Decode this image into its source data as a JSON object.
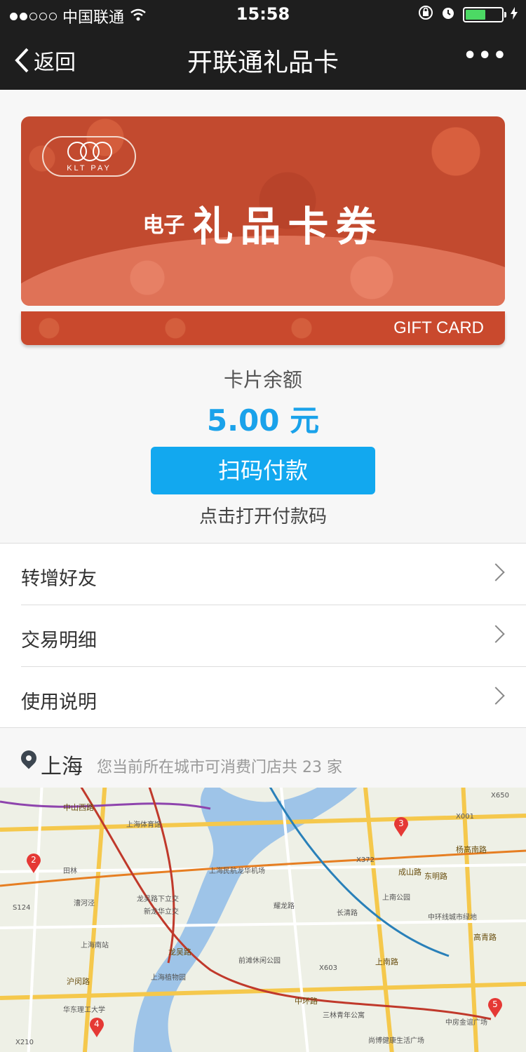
{
  "status_bar": {
    "carrier": "中国联通",
    "time": "15:58"
  },
  "nav": {
    "back_label": "返回",
    "title": "开联通礼品卡",
    "more_label": "•••"
  },
  "card": {
    "logo_text": "KLT PAY",
    "title_small": "电子",
    "title_big": "礼品卡券",
    "gift_card_label": "GIFT CARD"
  },
  "balance": {
    "label": "卡片余额",
    "amount": "5.00 元"
  },
  "scan_button": {
    "label": "扫码付款",
    "hint": "点击打开付款码"
  },
  "menu": {
    "items": [
      {
        "label": "转增好友"
      },
      {
        "label": "交易明细"
      },
      {
        "label": "使用说明"
      }
    ]
  },
  "location": {
    "city": "上海",
    "description": "您当前所在城市可消费门店共 23 家"
  },
  "map": {
    "places": [
      "上海体育馆",
      "田林",
      "漕河泾",
      "龙吴路下立交",
      "新龙华立交",
      "上海南站",
      "上海植物园",
      "华东理工大学",
      "上海民航龙华机场",
      "耀龙路",
      "前滩休闲公园",
      "长清路",
      "上南公园",
      "中环线城市绿地",
      "中房金谊广场",
      "尚博健康生活广场",
      "三林青年公寓"
    ],
    "roads": [
      "中山西路",
      "龙吴路",
      "成山路",
      "杨高南路",
      "中环路",
      "高青路",
      "沪闵路",
      "上南路",
      "东明路"
    ],
    "road_codes": [
      "X650",
      "X372",
      "S124",
      "X603",
      "X210",
      "X001"
    ],
    "markers": [
      "2",
      "3",
      "4",
      "5"
    ]
  }
}
